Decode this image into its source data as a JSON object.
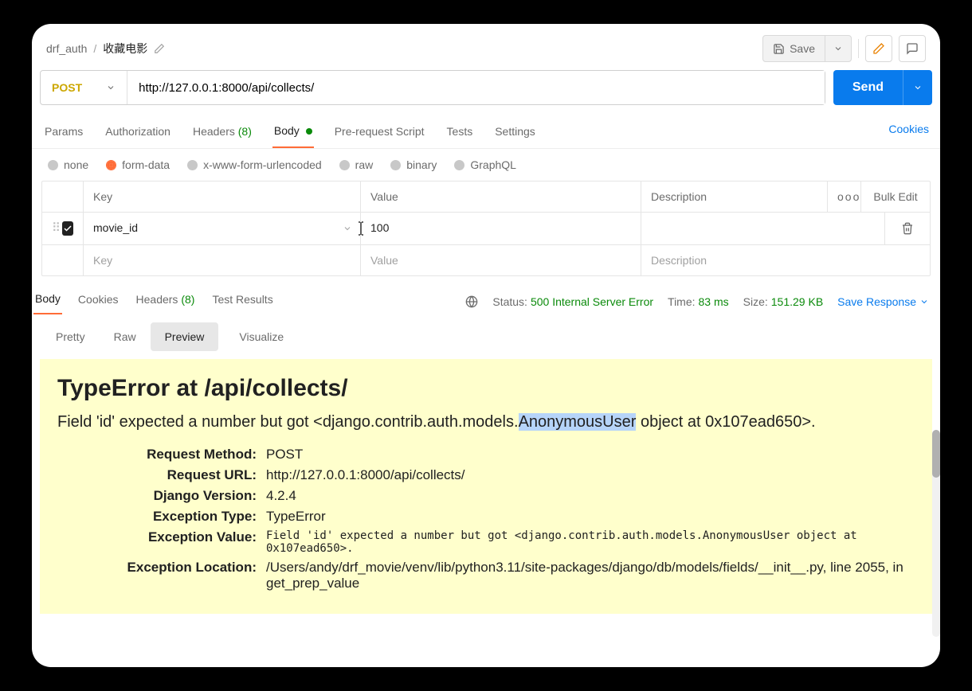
{
  "breadcrumb": {
    "root": "drf_auth",
    "sep": "/",
    "name": "收藏电影"
  },
  "toolbar": {
    "save": "Save"
  },
  "request": {
    "method": "POST",
    "url": "http://127.0.0.1:8000/api/collects/",
    "send": "Send"
  },
  "tabs": {
    "params": "Params",
    "auth": "Authorization",
    "headers": "Headers",
    "headers_count": "(8)",
    "body": "Body",
    "prereq": "Pre-request Script",
    "tests": "Tests",
    "settings": "Settings",
    "cookies": "Cookies"
  },
  "body_types": {
    "none": "none",
    "formdata": "form-data",
    "xform": "x-www-form-urlencoded",
    "raw": "raw",
    "binary": "binary",
    "graphql": "GraphQL"
  },
  "kv": {
    "head_key": "Key",
    "head_value": "Value",
    "head_desc": "Description",
    "more": "ooo",
    "bulk": "Bulk Edit",
    "rows": [
      {
        "key": "movie_id",
        "value": "100",
        "desc": ""
      }
    ],
    "ph_key": "Key",
    "ph_value": "Value",
    "ph_desc": "Description"
  },
  "response": {
    "tabs": {
      "body": "Body",
      "cookies": "Cookies",
      "headers": "Headers",
      "headers_count": "(8)",
      "tests": "Test Results"
    },
    "status_label": "Status:",
    "status_value": "500 Internal Server Error",
    "time_label": "Time:",
    "time_value": "83 ms",
    "size_label": "Size:",
    "size_value": "151.29 KB",
    "save": "Save Response",
    "view_tabs": {
      "pretty": "Pretty",
      "raw": "Raw",
      "preview": "Preview",
      "vis": "Visualize"
    },
    "error": {
      "title": "TypeError at /api/collects/",
      "sub_pre": "Field 'id' expected a number but got <django.contrib.auth.models.",
      "sub_hl": "AnonymousUser",
      "sub_post": " object at 0x107ead650>.",
      "meta": {
        "method_k": "Request Method:",
        "method_v": "POST",
        "url_k": "Request URL:",
        "url_v": "http://127.0.0.1:8000/api/collects/",
        "django_k": "Django Version:",
        "django_v": "4.2.4",
        "etype_k": "Exception Type:",
        "etype_v": "TypeError",
        "eval_k": "Exception Value:",
        "eval_v": "Field 'id' expected a number but got <django.contrib.auth.models.AnonymousUser object at 0x107ead650>.",
        "eloc_k": "Exception Location:",
        "eloc_v": "/Users/andy/drf_movie/venv/lib/python3.11/site-packages/django/db/models/fields/__init__.py, line 2055, in get_prep_value"
      }
    }
  }
}
